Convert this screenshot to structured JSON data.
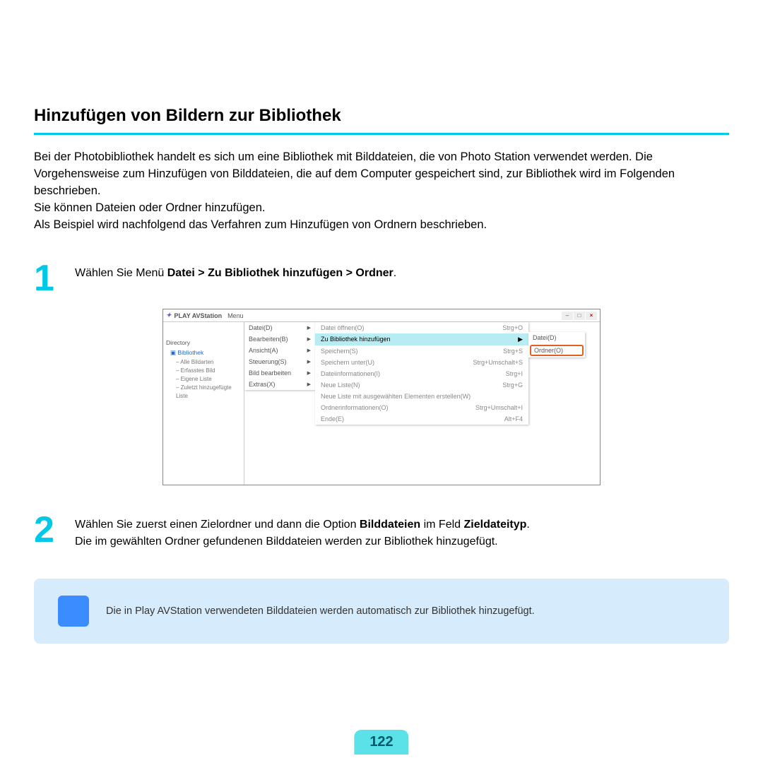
{
  "title": "Hinzufügen von Bildern zur Bibliothek",
  "intro": "Bei der Photobibliothek handelt es sich um eine Bibliothek mit Bilddateien, die von Photo Station verwendet werden. Die Vorgehensweise zum Hinzufügen von Bilddateien, die auf dem Computer gespeichert sind, zur Bibliothek wird im Folgenden beschrieben.\nSie können Dateien oder Ordner hinzufügen.\nAls Beispiel wird nachfolgend das Verfahren zum Hinzufügen von Ordnern beschrieben.",
  "step1": {
    "num": "1",
    "prefix": "Wählen Sie Menü ",
    "bold": "Datei > Zu Bibliothek hinzufügen > Ordner",
    "suffix": "."
  },
  "screenshot": {
    "app_title": "PLAY AVStation",
    "menu_word": "Menu",
    "sidebar_head": "Directory",
    "tree_root": "Bibliothek",
    "tree_items": [
      "– Alle Bildarten",
      "– Erfasstes Bild",
      "– Eigene Liste",
      "– Zuletzt hinzugefügte Liste"
    ],
    "menu1": [
      "Datei(D)",
      "Bearbeiten(B)",
      "Ansicht(A)",
      "Steuerung(S)",
      "Bild bearbeiten",
      "Extras(X)"
    ],
    "menu2": [
      {
        "label": "Datei öffnen(O)",
        "short": "Strg+O"
      },
      {
        "label": "Zu Bibliothek hinzufügen",
        "short": "",
        "hl": true,
        "arrow": true
      },
      {
        "label": "Speichern(S)",
        "short": "Strg+S"
      },
      {
        "label": "Speichern unter(U)",
        "short": "Strg+Umschalt+S"
      },
      {
        "label": "Dateiinformationen(I)",
        "short": "Strg+I"
      },
      {
        "label": "Neue Liste(N)",
        "short": "Strg+G"
      },
      {
        "label": "Neue Liste mit ausgewählten Elementen erstellen(W)",
        "short": ""
      },
      {
        "label": "Ordnerinformationen(O)",
        "short": "Strg+Umschalt+I"
      },
      {
        "label": "Ende(E)",
        "short": "Alt+F4"
      }
    ],
    "menu3": [
      {
        "label": "Datei(D)"
      },
      {
        "label": "Ordner(O)",
        "sel": true
      }
    ]
  },
  "step2": {
    "num": "2",
    "line1_pre": "Wählen Sie zuerst einen Zielordner und dann die Option ",
    "line1_bold1": "Bilddateien",
    "line1_mid": " im Feld ",
    "line1_bold2": "Zieldateityp",
    "line1_suf": ".",
    "line2": "Die im gewählten Ordner gefundenen Bilddateien werden zur Bibliothek hinzugefügt."
  },
  "note": "Die in Play AVStation verwendeten Bilddateien werden automatisch zur Bibliothek hinzugefügt.",
  "page": "122"
}
